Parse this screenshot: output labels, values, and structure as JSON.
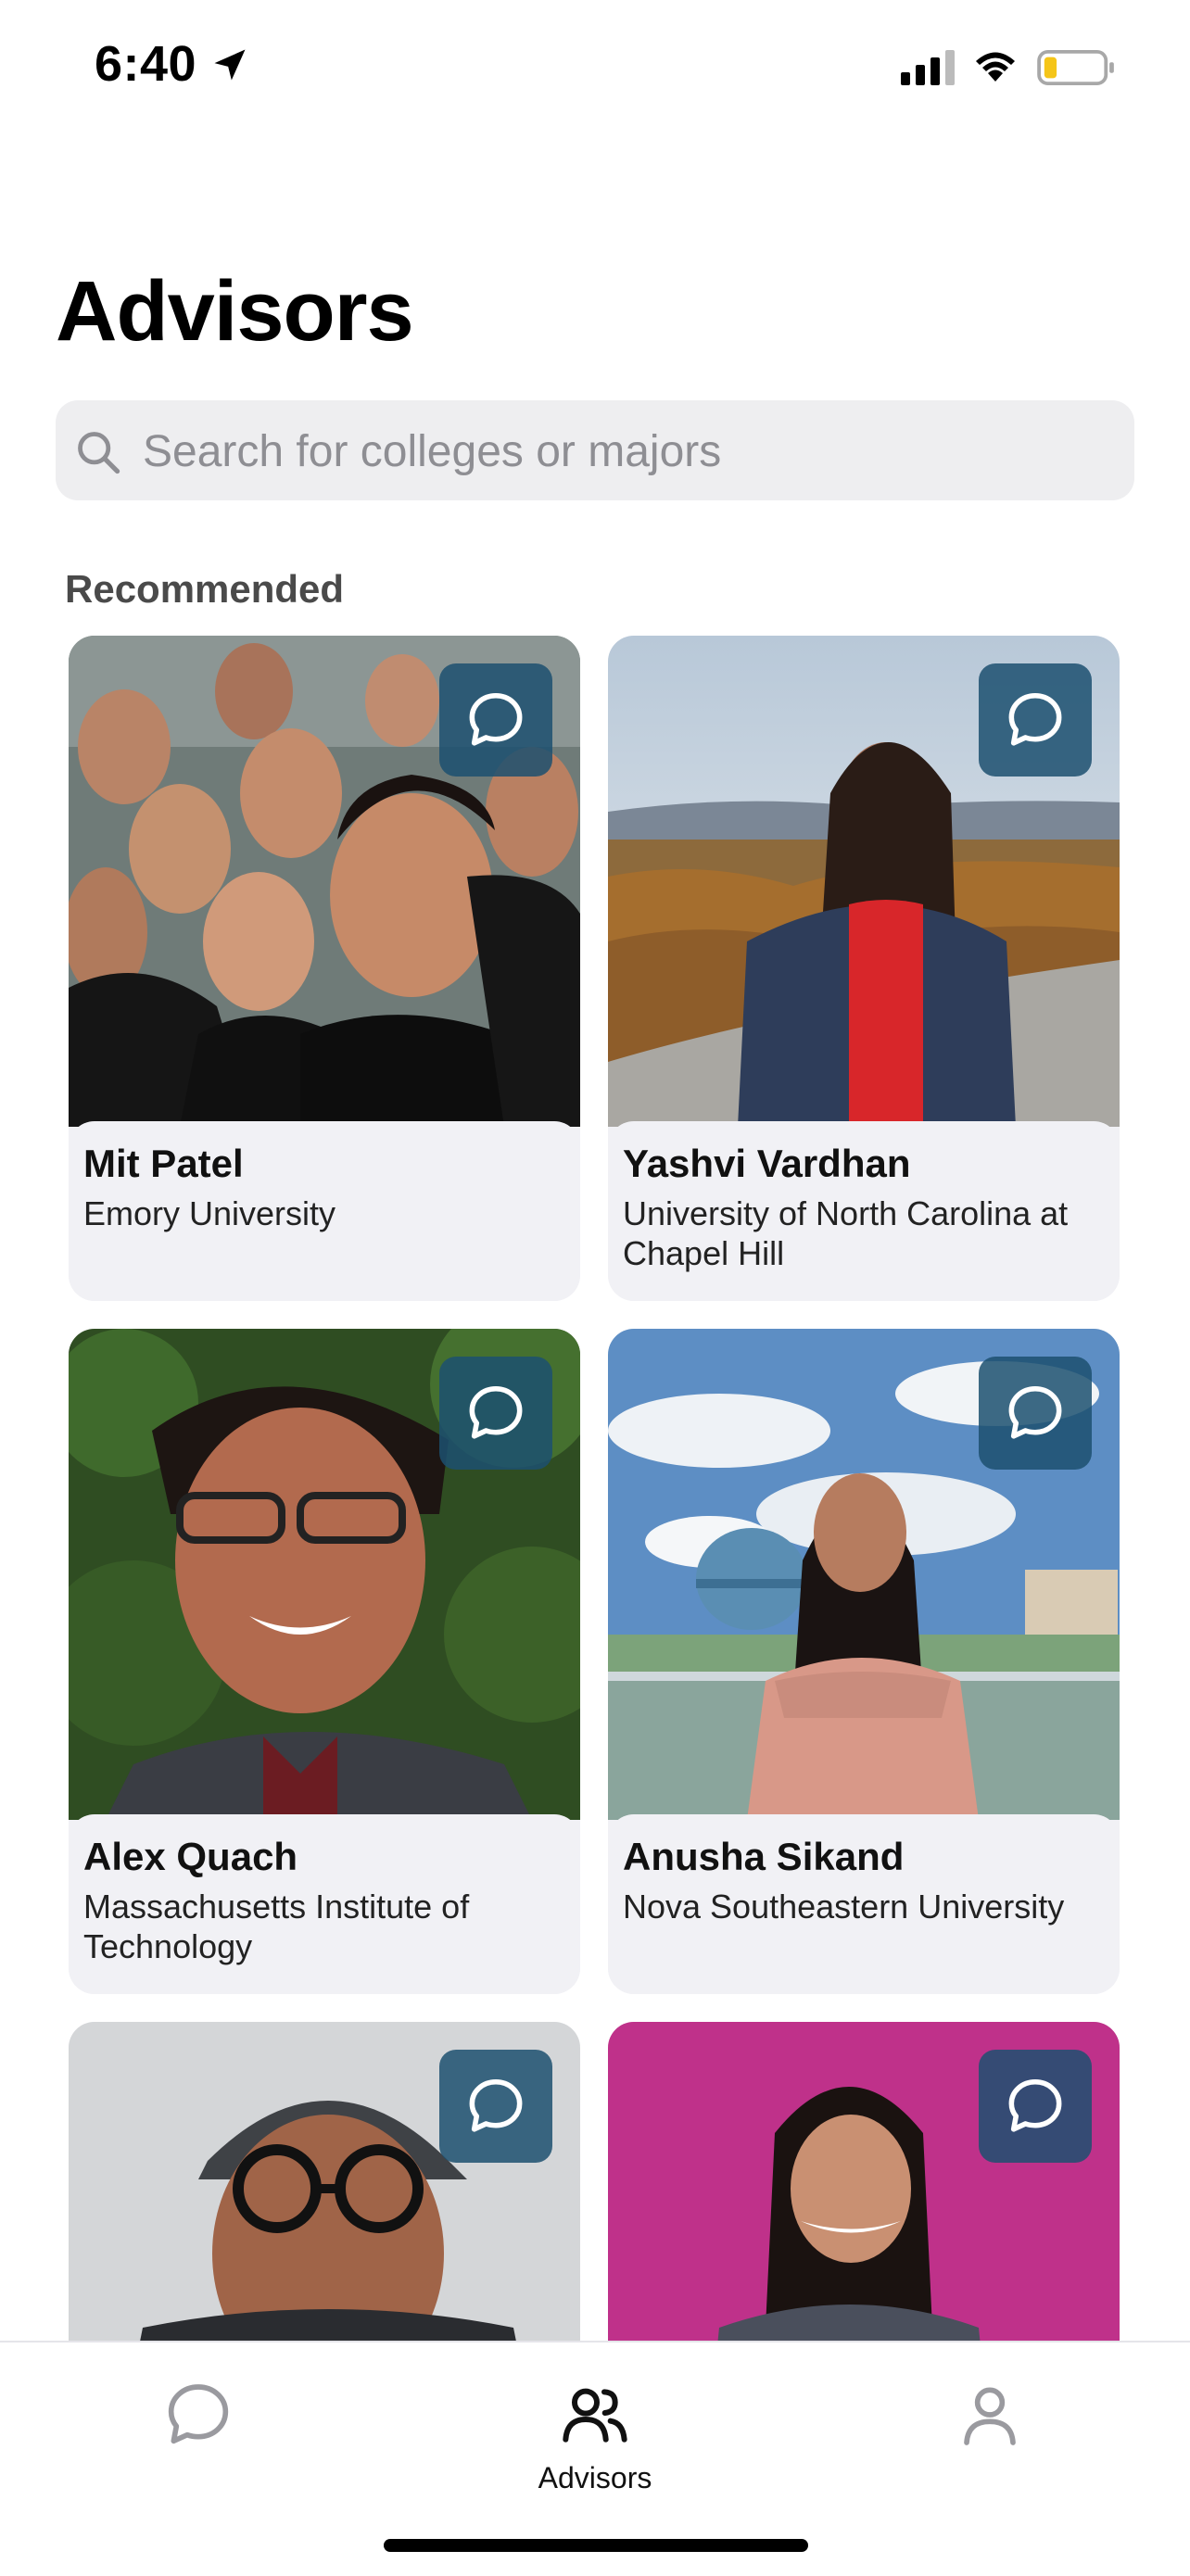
{
  "status_bar": {
    "time": "6:40"
  },
  "header": {
    "title": "Advisors"
  },
  "search": {
    "placeholder": "Search for colleges or majors"
  },
  "section": {
    "title": "Recommended"
  },
  "advisors": [
    {
      "name": "Mit Patel",
      "school": "Emory University"
    },
    {
      "name": "Yashvi Vardhan",
      "school": "University of North Carolina at Chapel Hill"
    },
    {
      "name": "Alex Quach",
      "school": "Massachusetts Institute of Technology"
    },
    {
      "name": "Anusha Sikand",
      "school": "Nova Southeastern University"
    },
    {
      "name": "",
      "school": ""
    },
    {
      "name": "",
      "school": ""
    }
  ],
  "tab_bar": {
    "tabs": [
      {
        "icon": "chat-bubble-icon",
        "label": ""
      },
      {
        "icon": "people-icon",
        "label": "Advisors",
        "active": true
      },
      {
        "icon": "person-icon",
        "label": ""
      }
    ]
  },
  "colors": {
    "chat_button": "#1c5070",
    "card_background": "#f1f1f5",
    "search_background": "#eeeef0"
  }
}
